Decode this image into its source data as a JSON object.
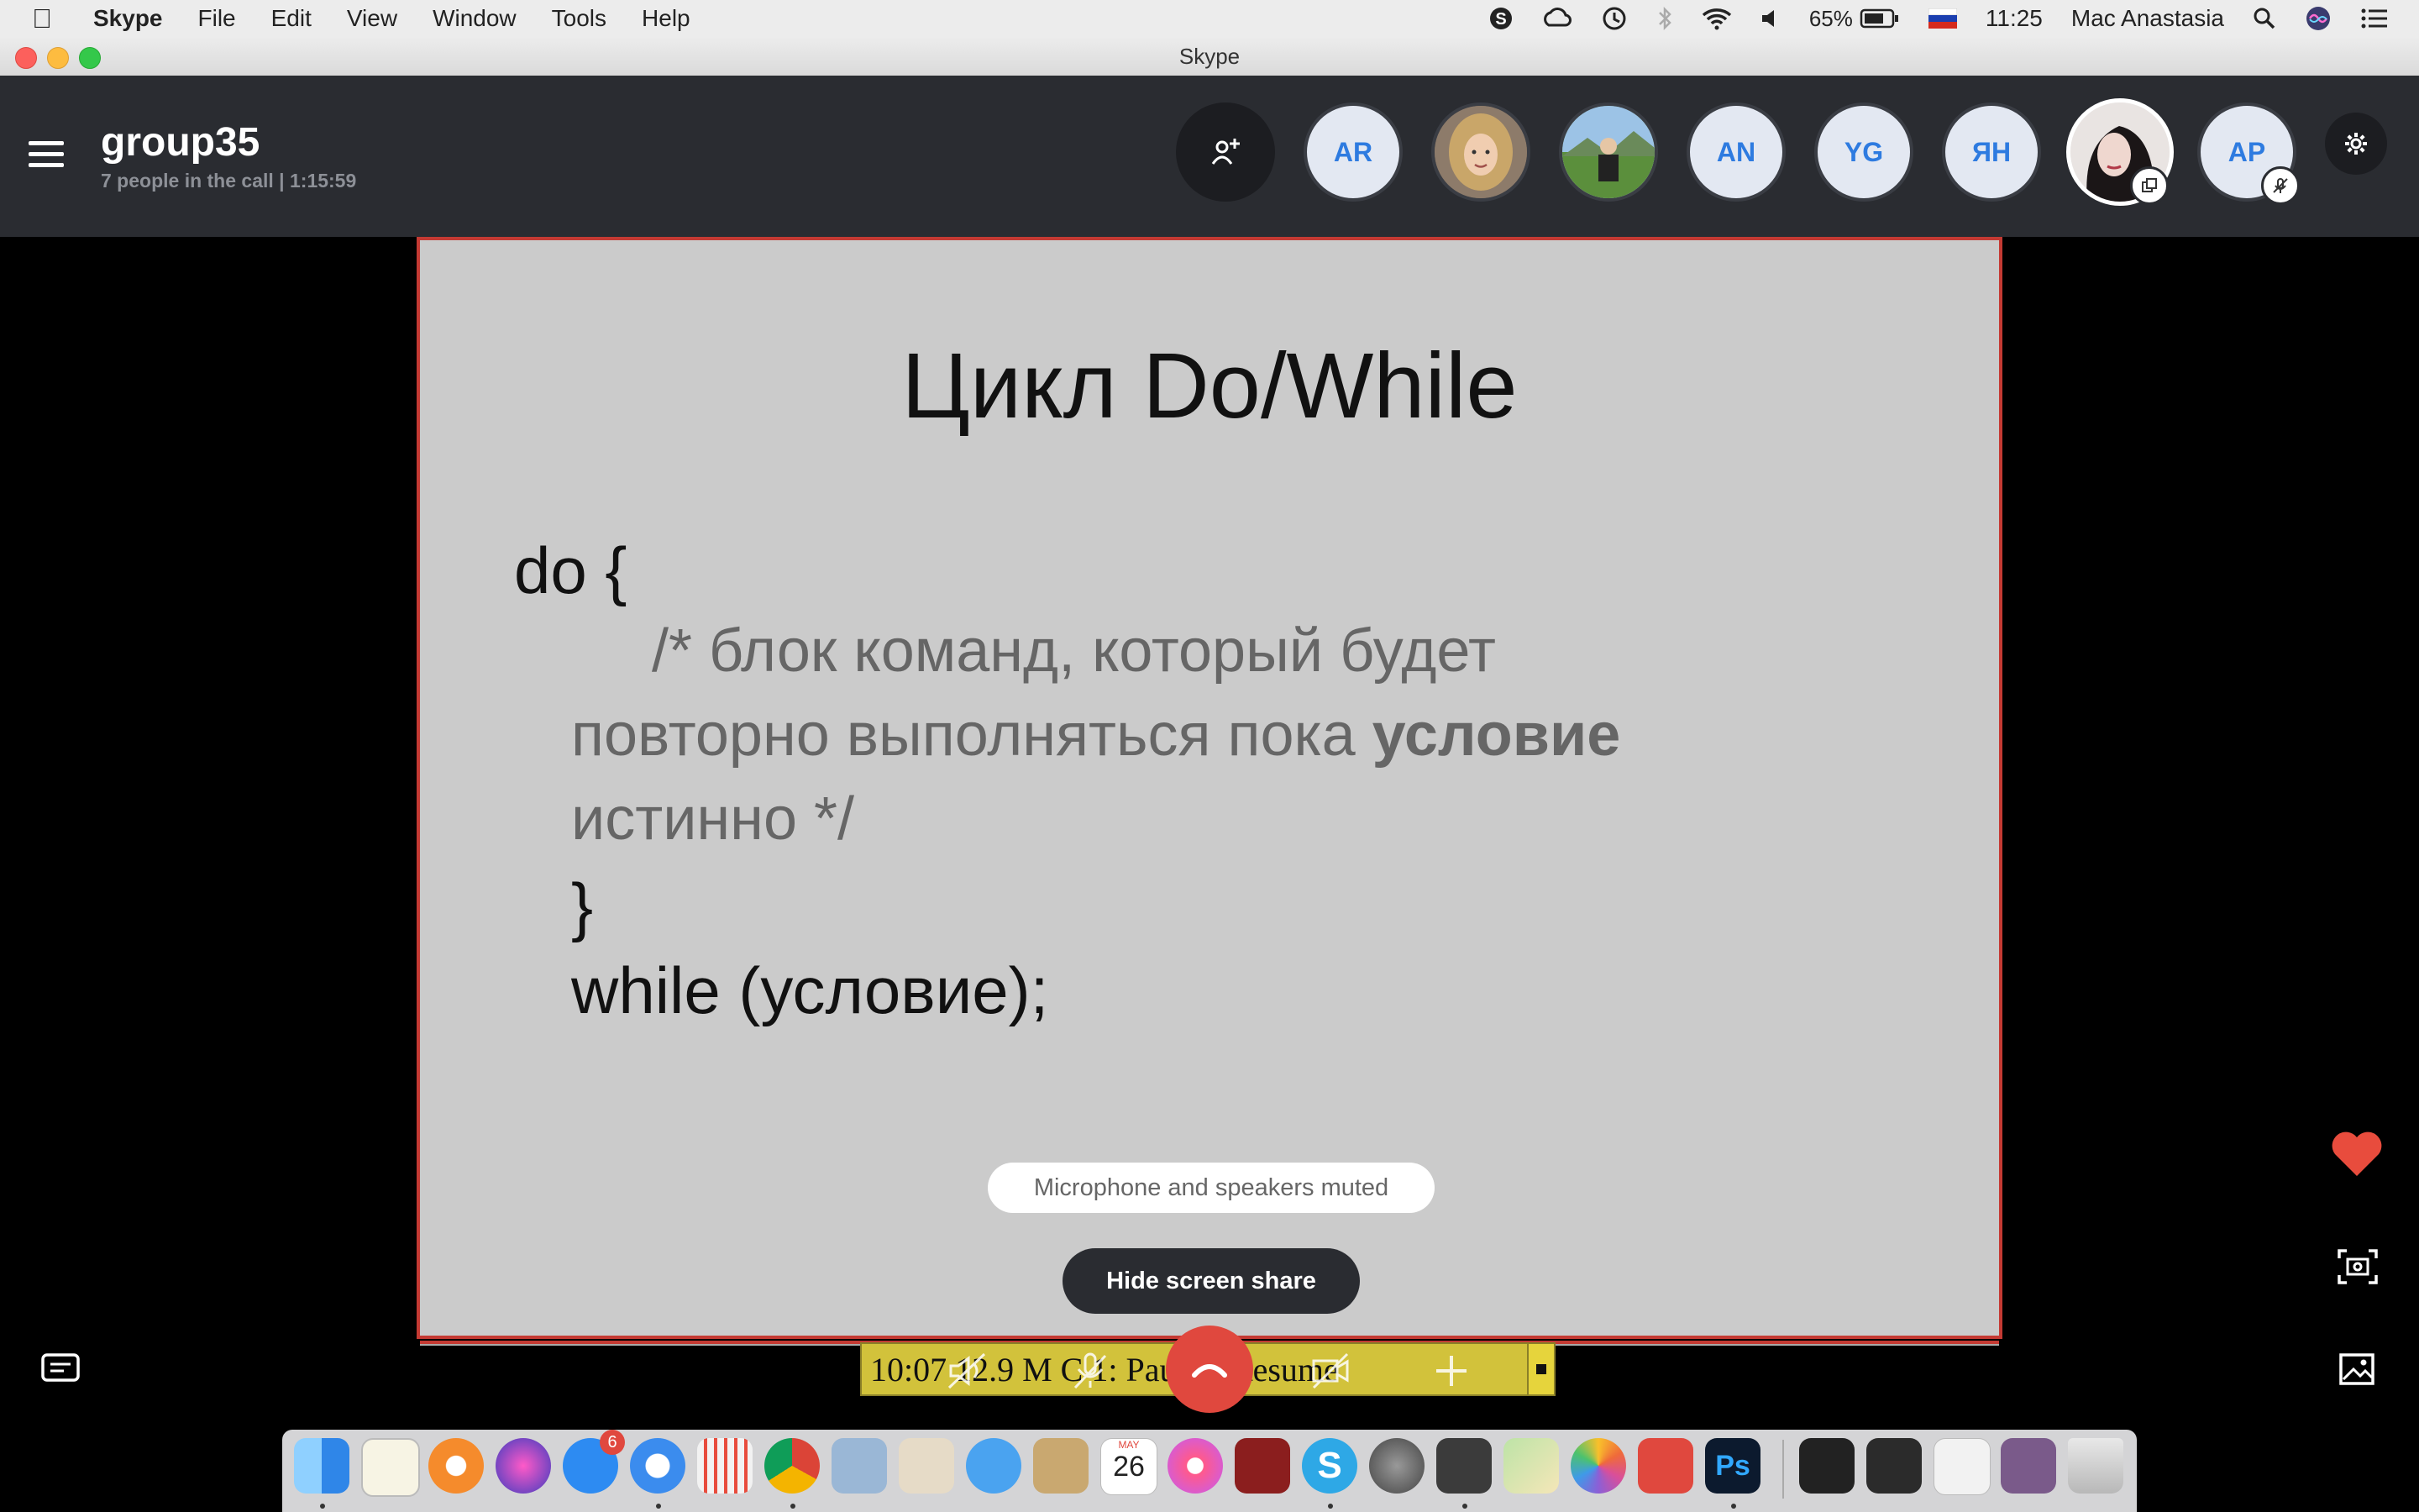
{
  "menubar": {
    "app_name": "Skype",
    "items": [
      "File",
      "Edit",
      "View",
      "Window",
      "Tools",
      "Help"
    ],
    "battery": "65%",
    "time": "11:25",
    "user": "Mac Anastasia",
    "status_icons": [
      "skype-status-icon",
      "creative-cloud-icon",
      "time-machine-icon",
      "bluetooth-icon",
      "wifi-icon",
      "volume-icon",
      "battery-icon",
      "flag-ru-icon",
      "spotlight-icon",
      "siri-icon",
      "notification-center-icon"
    ]
  },
  "window": {
    "title": "Skype"
  },
  "call": {
    "group_name": "group35",
    "subtitle": "7 people in the call | 1:15:59",
    "participants": [
      {
        "initials": "AR",
        "type": "initials"
      },
      {
        "initials": "",
        "type": "photo",
        "label": "woman-blonde-photo"
      },
      {
        "initials": "",
        "type": "photo",
        "label": "man-outdoors-photo"
      },
      {
        "initials": "AN",
        "type": "initials"
      },
      {
        "initials": "YG",
        "type": "initials"
      },
      {
        "initials": "ЯН",
        "type": "initials"
      },
      {
        "initials": "",
        "type": "photo",
        "label": "woman-dark-hair-photo"
      },
      {
        "initials": "AP",
        "type": "initials"
      }
    ]
  },
  "slide": {
    "title": "Цикл Do/While",
    "line1": "do {",
    "comment_line1": "/* блок команд, который будет",
    "comment_line2_a": "повторно выполняться пока ",
    "comment_line2_b": "условие",
    "comment_line3": "истинно */",
    "close_brace": "}",
    "while_line": "while (условие);"
  },
  "overlay": {
    "muted_text": "Microphone and speakers muted",
    "hide_share_label": "Hide screen share",
    "recorder_text": "10:07  12.9 M   C   1: Pause / Resume"
  },
  "colors": {
    "header_bg": "#2a2c31",
    "avatar_text": "#2e7be0",
    "end_call": "#e0483e",
    "share_border": "#c43a33",
    "heart": "#e84c3d"
  },
  "dock": {
    "apps": [
      "finder-icon",
      "textedit-icon",
      "origin-icon",
      "siri-icon",
      "app-store-icon",
      "safari-icon",
      "launchpad-icon",
      "chrome-icon",
      "preview-icon",
      "file-icon",
      "mail-icon",
      "notes-icon",
      "calendar-icon",
      "itunes-icon",
      "photo-booth-icon",
      "skype-icon",
      "system-preferences-icon",
      "sublime-text-icon",
      "maps-icon",
      "photos-icon",
      "creative-cloud-icon",
      "photoshop-icon",
      "window-thumb-1",
      "window-thumb-2",
      "window-thumb-3",
      "window-thumb-4",
      "trash-icon"
    ],
    "app_store_badge": "6",
    "calendar_month": "MAY",
    "calendar_day": "26",
    "photoshop_label": "Ps"
  }
}
